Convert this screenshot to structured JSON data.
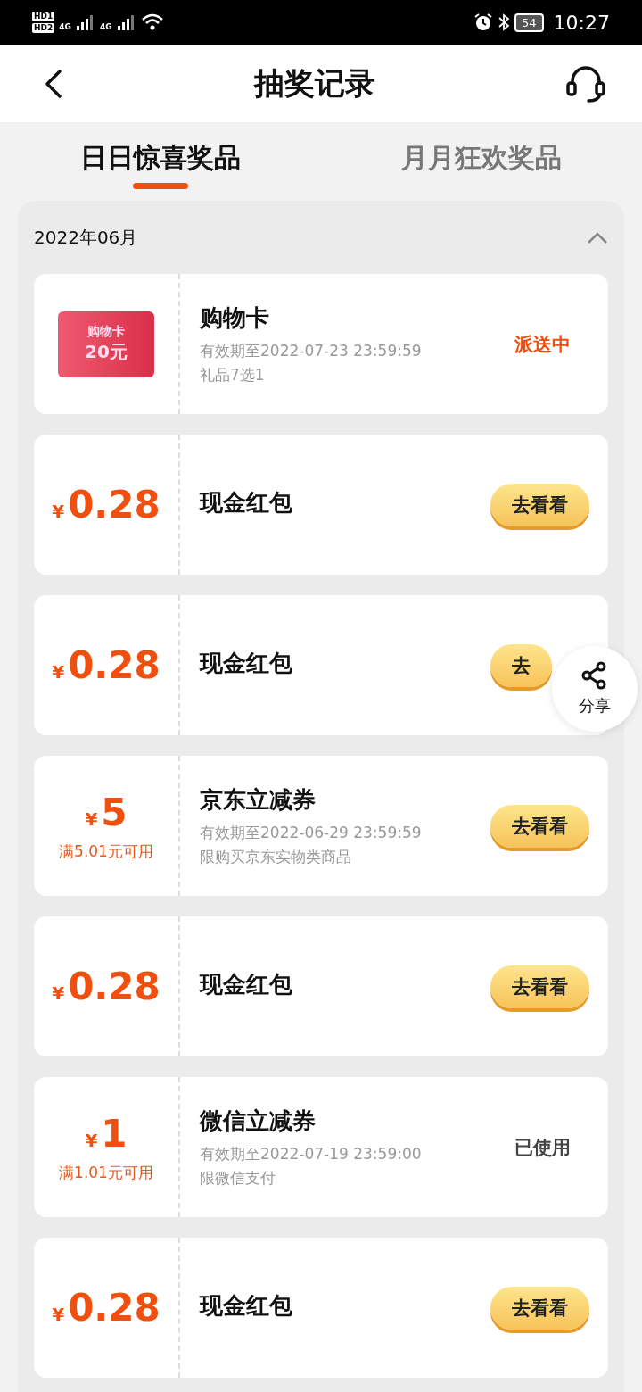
{
  "status_bar": {
    "sims": [
      "HD1",
      "HD2"
    ],
    "networks": [
      "4G",
      "4G"
    ],
    "battery": "54",
    "time": "10:27"
  },
  "header": {
    "title": "抽奖记录"
  },
  "tabs": [
    {
      "label": "日日惊喜奖品",
      "selected": true
    },
    {
      "label": "月月狂欢奖品",
      "selected": false
    }
  ],
  "month": {
    "label": "2022年06月",
    "expanded": true
  },
  "records": [
    {
      "kind": "card",
      "badge_title": "购物卡",
      "badge_value": "20元",
      "name": "购物卡",
      "lines": [
        "有效期至2022-07-23 23:59:59",
        "礼品7选1"
      ],
      "action": {
        "kind": "status",
        "label": "派送中",
        "color": "#f0500f"
      }
    },
    {
      "kind": "cash",
      "currency": "¥",
      "amount": "0.28",
      "name": "现金红包",
      "action": {
        "kind": "button",
        "label": "去看看"
      }
    },
    {
      "kind": "cash",
      "currency": "¥",
      "amount": "0.28",
      "name": "现金红包",
      "action": {
        "kind": "button",
        "label": "去"
      }
    },
    {
      "kind": "coupon",
      "currency": "¥",
      "amount": "5",
      "condition": "满5.01元可用",
      "name": "京东立减券",
      "lines": [
        "有效期至2022-06-29 23:59:59",
        "限购买京东实物类商品"
      ],
      "action": {
        "kind": "button",
        "label": "去看看"
      }
    },
    {
      "kind": "cash",
      "currency": "¥",
      "amount": "0.28",
      "name": "现金红包",
      "action": {
        "kind": "button",
        "label": "去看看"
      }
    },
    {
      "kind": "coupon",
      "currency": "¥",
      "amount": "1",
      "condition": "满1.01元可用",
      "name": "微信立减券",
      "lines": [
        "有效期至2022-07-19 23:59:00",
        "限微信支付"
      ],
      "action": {
        "kind": "status",
        "label": "已使用",
        "color": "#444444"
      }
    },
    {
      "kind": "cash",
      "currency": "¥",
      "amount": "0.28",
      "name": "现金红包",
      "action": {
        "kind": "button",
        "label": "去看看"
      }
    }
  ],
  "share": {
    "label": "分享"
  }
}
